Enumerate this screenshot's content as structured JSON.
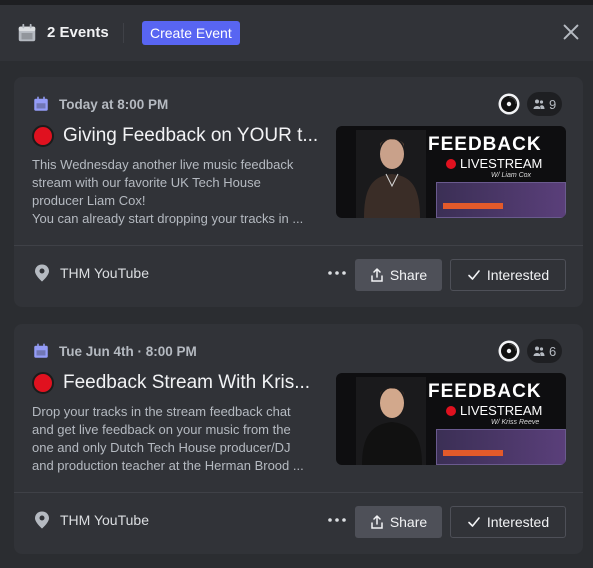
{
  "header": {
    "events_count_label": "2 Events",
    "create_button_label": "Create Event"
  },
  "colors": {
    "accent": "#5865f2",
    "live_dot": "#e0111f",
    "background": "#2b2d31",
    "card": "#313338"
  },
  "events": [
    {
      "when": "Today at 8:00 PM",
      "interested_count": "9",
      "title": "Giving Feedback on YOUR t...",
      "description": [
        "This Wednesday another live music feedback",
        "stream with our favorite UK Tech House",
        "producer Liam Cox!",
        "You can already start dropping your tracks in ..."
      ],
      "thumbnail": {
        "headline": "FEEDBACK",
        "subline": "LIVESTREAM",
        "with": "W/ Liam Cox"
      },
      "location": "THM YouTube",
      "share_label": "Share",
      "interested_label": "Interested"
    },
    {
      "when": "Tue Jun 4th · 8:00 PM",
      "interested_count": "6",
      "title": "Feedback Stream With Kris...",
      "description": [
        "Drop your tracks in the stream feedback chat",
        "and get live feedback on your music from the",
        "one and only Dutch Tech House producer/DJ",
        "and production teacher at the Herman Brood ..."
      ],
      "thumbnail": {
        "headline": "FEEDBACK",
        "subline": "LIVESTREAM",
        "with": "W/ Kriss Reeve"
      },
      "location": "THM YouTube",
      "share_label": "Share",
      "interested_label": "Interested"
    }
  ]
}
